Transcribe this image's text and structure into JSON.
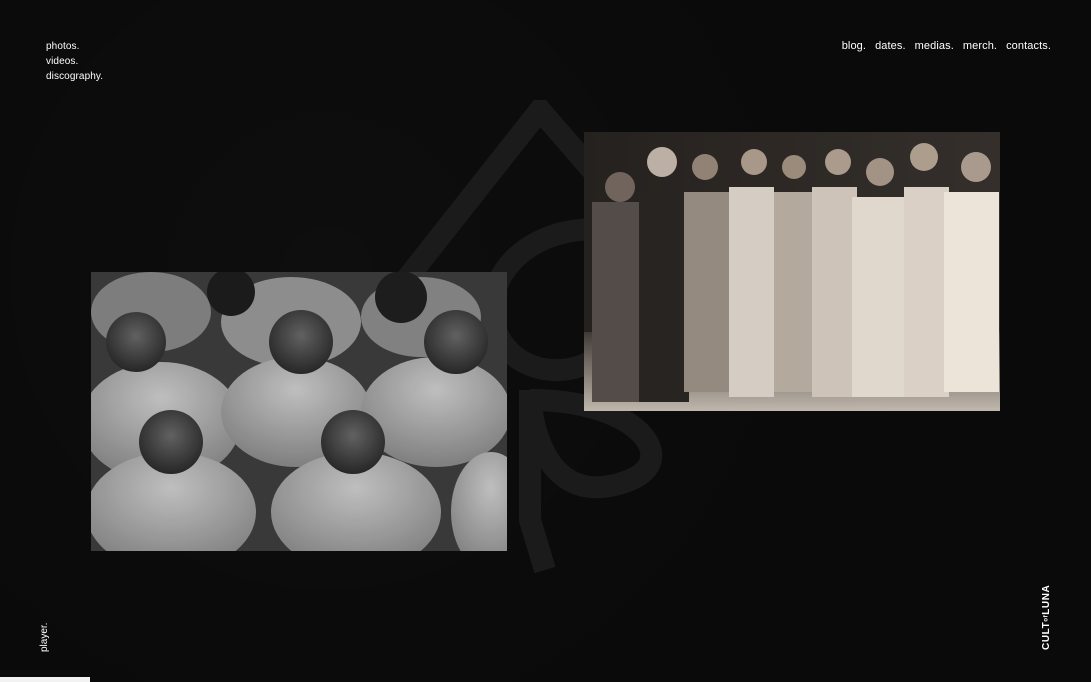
{
  "left_nav": {
    "items": [
      {
        "label": "photos."
      },
      {
        "label": "videos."
      },
      {
        "label": "discography."
      }
    ]
  },
  "right_nav": {
    "items": [
      {
        "label": "blog."
      },
      {
        "label": "dates."
      },
      {
        "label": "medias."
      },
      {
        "label": "merch."
      },
      {
        "label": "contacts."
      }
    ]
  },
  "player": {
    "label": "player."
  },
  "brand": {
    "part1": "CULT",
    "part2": "of",
    "part3": "LUNA"
  },
  "icons": {
    "watermark": "band-logo-watermark-icon"
  },
  "colors": {
    "background": "#0a0a0a",
    "text": "#ffffff",
    "watermark": "#1c1c1c",
    "progress": "#f2f2f2"
  }
}
